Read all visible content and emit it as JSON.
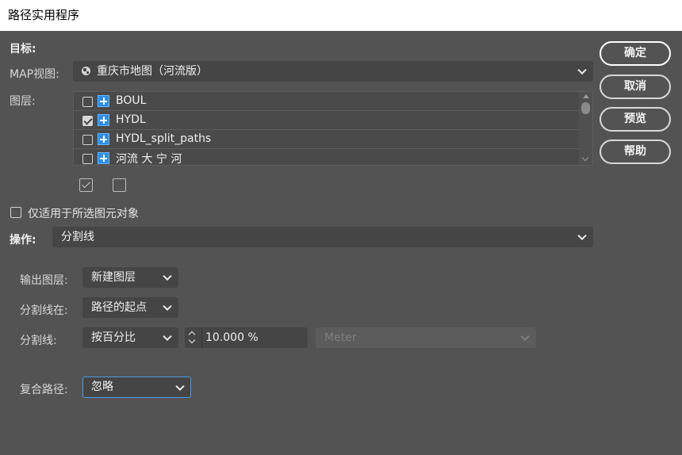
{
  "window": {
    "title": "路径实用程序"
  },
  "target": {
    "label": "目标:",
    "map_view_label": "MAP视图:",
    "map_view_value": "重庆市地图（河流版）",
    "layers_label": "图层:",
    "layers": [
      {
        "name": "BOUL",
        "checked": false
      },
      {
        "name": "HYDL",
        "checked": true
      },
      {
        "name": "HYDL_split_paths",
        "checked": false
      },
      {
        "name": "河流  大 宁 河",
        "checked": false
      }
    ],
    "only_selected_label": "仅适用于所选图元对象"
  },
  "operation": {
    "label": "操作:",
    "value": "分割线"
  },
  "options": {
    "output_layer_label": "输出图层:",
    "output_layer_value": "新建图层",
    "split_at_label": "分割线在:",
    "split_at_value": "路径的起点",
    "split_by_label": "分割线:",
    "split_by_value": "按百分比",
    "percent_value": "10.000 %",
    "unit_value": "Meter",
    "compound_label": "复合路径:",
    "compound_value": "忽略"
  },
  "buttons": {
    "ok": "确定",
    "cancel": "取消",
    "preview": "预览",
    "help": "帮助"
  }
}
